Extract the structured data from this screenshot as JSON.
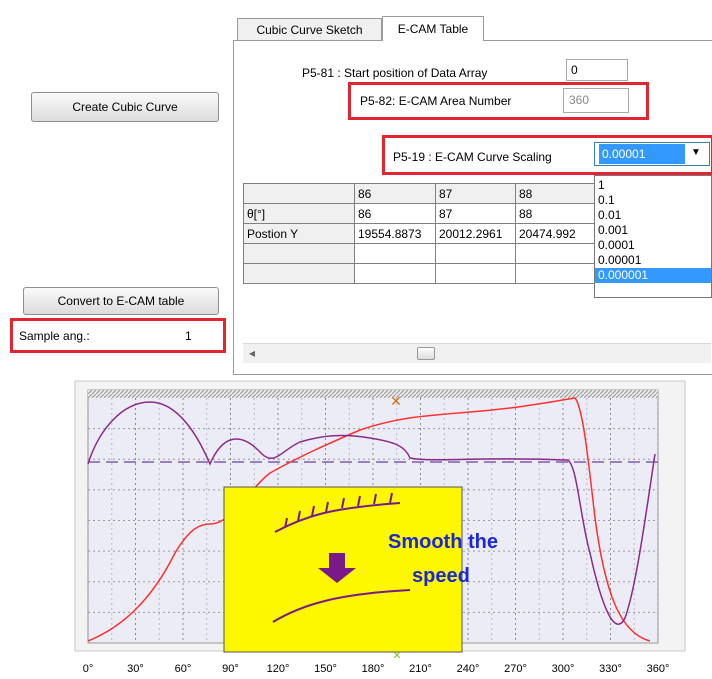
{
  "left_panel": {
    "create_cubic_curve": "Create Cubic Curve",
    "convert_ecam": "Convert to E-CAM table",
    "sample_ang_label": "Sample ang.:",
    "sample_ang_value": "1"
  },
  "tabs": [
    {
      "label": "Cubic Curve Sketch",
      "active": false
    },
    {
      "label": "E-CAM Table",
      "active": true
    }
  ],
  "params": {
    "p581_label": "P5-81 : Start position of Data Array",
    "p581_value": "0",
    "p582_label": "P5-82: E-CAM Area Number",
    "p582_value": "360",
    "p519_label": "P5-19 : E-CAM Curve Scaling",
    "p519_value": "0.00001"
  },
  "scaling_options": [
    "1",
    "0.1",
    "0.01",
    "0.001",
    "0.0001",
    "0.00001",
    "0.000001"
  ],
  "scaling_highlighted": "0.000001",
  "table": {
    "headers": [
      "86",
      "87",
      "88"
    ],
    "rows": [
      {
        "label": "θ[°]",
        "values": [
          "86",
          "87",
          "88"
        ]
      },
      {
        "label": "Postion Y",
        "values": [
          "19554.8873",
          "20012.2961",
          "20474.992"
        ]
      },
      {
        "label": "",
        "values": [
          "",
          "",
          ""
        ]
      },
      {
        "label": "",
        "values": [
          "",
          "",
          ""
        ]
      }
    ]
  },
  "scroll_left_arrow": "◂",
  "chart": {
    "x_ticks": [
      "0°",
      "30°",
      "60°",
      "90°",
      "120°",
      "150°",
      "180°",
      "210°",
      "240°",
      "270°",
      "300°",
      "330°",
      "360°"
    ],
    "callout": {
      "line1": "Smooth the",
      "line2": "speed",
      "bg_color": "#fdf800",
      "text_color": "#1a28d6",
      "arrow_color": "#7a1a8a"
    },
    "position_color": "#ff3030",
    "speed_color": "#8a2a8a"
  }
}
